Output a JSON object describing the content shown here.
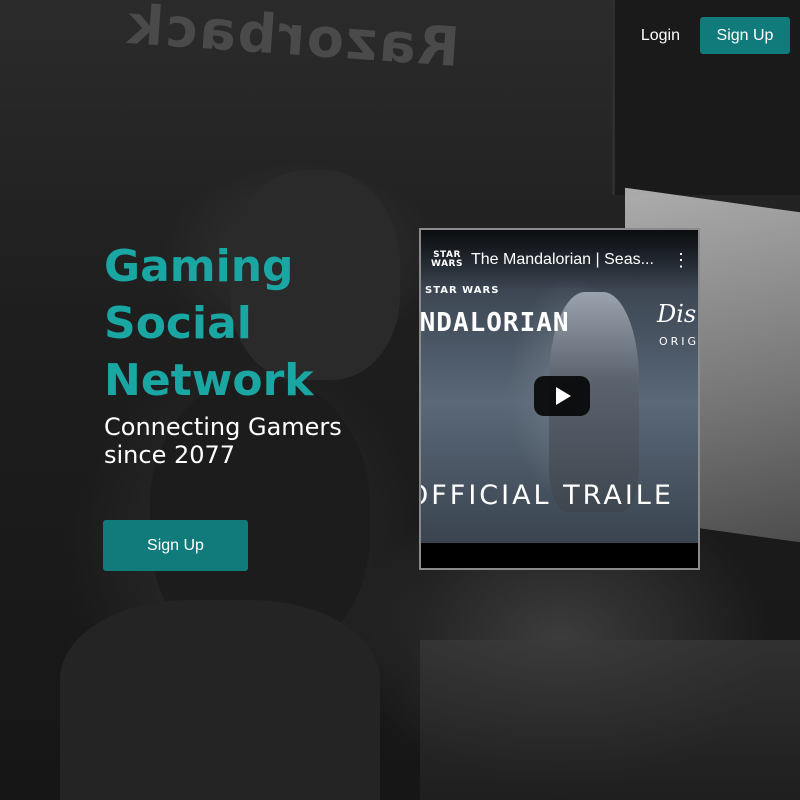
{
  "background": {
    "wall_sign": "Razorback"
  },
  "nav": {
    "login_label": "Login",
    "signup_label": "Sign Up"
  },
  "hero": {
    "title_line1": "Gaming",
    "title_line2": "Social",
    "title_line3": "Network",
    "subtitle": "Connecting Gamers since 2077",
    "signup_label": "Sign Up"
  },
  "video": {
    "title": "The Mandalorian | Seas...",
    "channel_logo_line1": "STAR",
    "channel_logo_line2": "WARS",
    "thumbnail_brand": "STAR WARS",
    "thumbnail_show": "ANDALORIAN",
    "thumbnail_disney": "Disn",
    "thumbnail_originals": "ORIGI",
    "thumbnail_caption": "OFFICIAL TRAILE",
    "play_icon": "play-icon",
    "menu_icon": "kebab-menu-icon"
  },
  "colors": {
    "accent": "#117a7a",
    "title_teal": "#1aa6a2",
    "text": "#ffffff"
  }
}
